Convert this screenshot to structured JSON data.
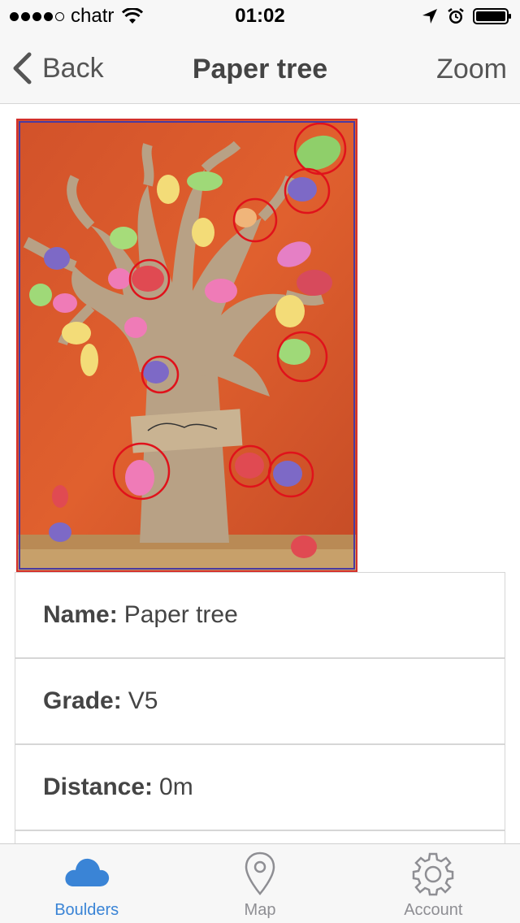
{
  "status_bar": {
    "carrier": "chatr",
    "time": "01:02",
    "signal_bars_filled": 4,
    "signal_bars_total": 5,
    "icons": [
      "wifi-icon",
      "location-arrow-icon",
      "alarm-icon",
      "battery-icon"
    ]
  },
  "nav": {
    "back_label": "Back",
    "title": "Paper tree",
    "zoom_label": "Zoom"
  },
  "photo": {
    "description_icon": "boulder-photo",
    "hold_marker_count": 11,
    "marker_color": "#e0121b",
    "frame_color": "#d3302b"
  },
  "details": {
    "rows": [
      {
        "label": "Name:",
        "value": "Paper tree"
      },
      {
        "label": "Grade:",
        "value": "V5"
      },
      {
        "label": "Distance:",
        "value": "0m"
      }
    ]
  },
  "tabs": [
    {
      "label": "Boulders",
      "icon": "cloud-icon",
      "active": true
    },
    {
      "label": "Map",
      "icon": "map-pin-icon",
      "active": false
    },
    {
      "label": "Account",
      "icon": "gear-icon",
      "active": false
    }
  ],
  "colors": {
    "accent": "#3a84d6",
    "inactive": "#8e8e93",
    "bar_background": "#f7f7f7"
  }
}
